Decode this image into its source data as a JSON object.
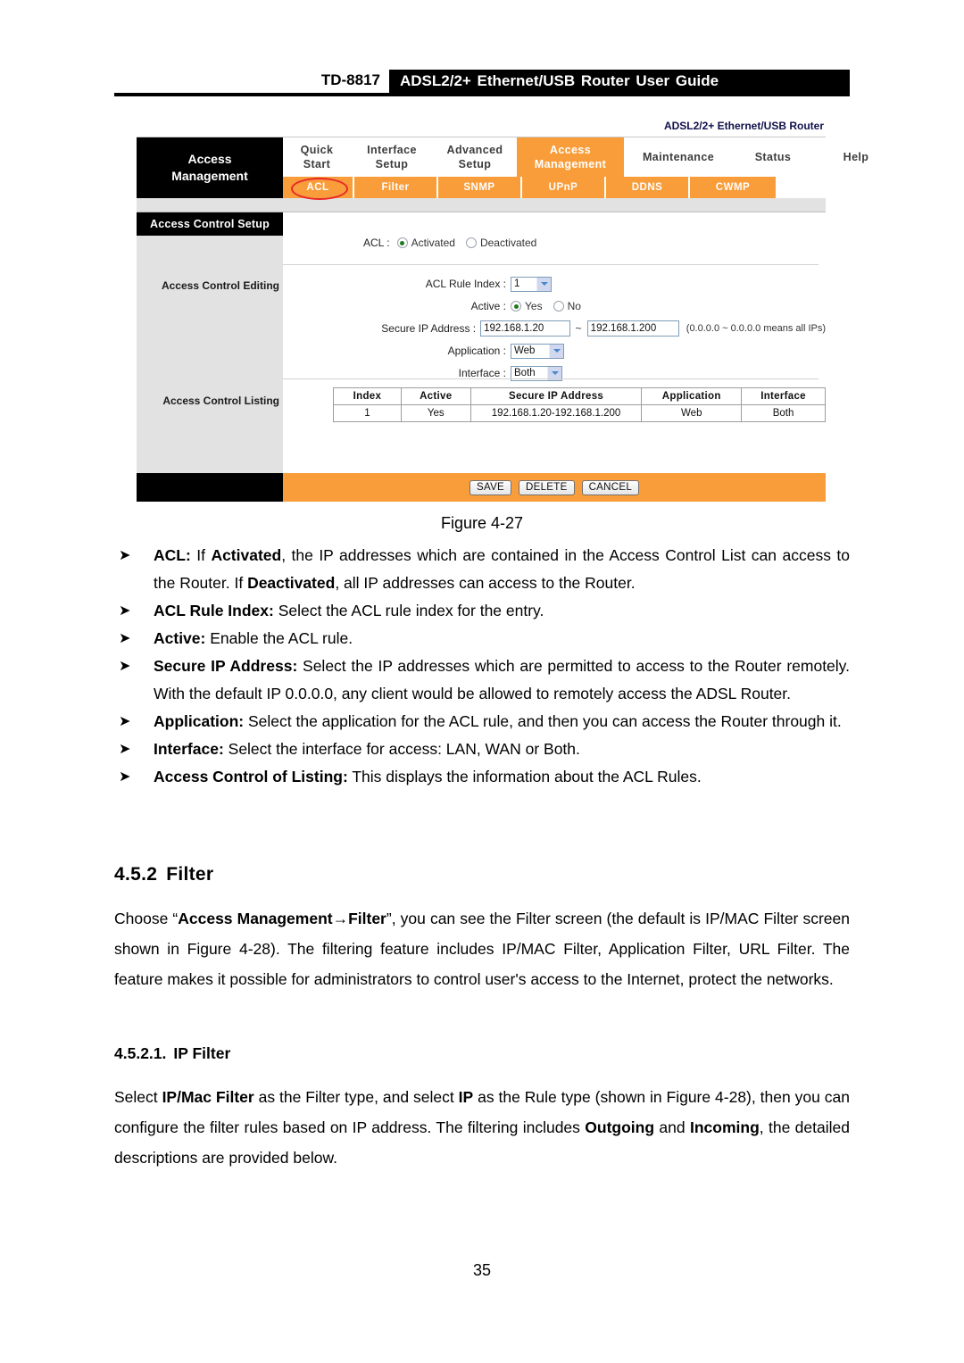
{
  "header": {
    "model": "TD-8817",
    "title": "ADSL2/2+ Ethernet/USB Router User Guide"
  },
  "router_ui": {
    "brandline": "ADSL2/2+ Ethernet/USB Router",
    "logo_line1": "Access",
    "logo_line2": "Management",
    "main_tabs": [
      {
        "line1": "Quick",
        "line2": "Start",
        "active": false
      },
      {
        "line1": "Interface",
        "line2": "Setup",
        "active": false
      },
      {
        "line1": "Advanced",
        "line2": "Setup",
        "active": false
      },
      {
        "line1": "Access",
        "line2": "Management",
        "active": true
      },
      {
        "line1": "Maintenance",
        "line2": "",
        "active": false
      },
      {
        "line1": "Status",
        "line2": "",
        "active": false
      },
      {
        "line1": "Help",
        "line2": "",
        "active": false
      }
    ],
    "sub_tabs": [
      {
        "label": "ACL",
        "selected": true
      },
      {
        "label": "Filter",
        "selected": false
      },
      {
        "label": "SNMP",
        "selected": false
      },
      {
        "label": "UPnP",
        "selected": false
      },
      {
        "label": "DDNS",
        "selected": false
      },
      {
        "label": "CWMP",
        "selected": false
      }
    ],
    "left_panel": {
      "title": "Access Control Setup",
      "editing_label": "Access Control Editing",
      "listing_label": "Access Control Listing"
    },
    "form": {
      "acl_label": "ACL :",
      "acl_option_activated": "Activated",
      "acl_option_deactivated": "Deactivated",
      "acl_selected": "Activated",
      "rule_index_label": "ACL Rule Index :",
      "rule_index_value": "1",
      "active_label": "Active :",
      "active_yes": "Yes",
      "active_no": "No",
      "active_selected": "Yes",
      "secure_ip_label": "Secure IP Address :",
      "secure_ip_start": "192.168.1.20",
      "secure_ip_separator": "~",
      "secure_ip_end": "192.168.1.200",
      "secure_ip_hint": "(0.0.0.0 ~ 0.0.0.0 means all IPs)",
      "application_label": "Application :",
      "application_value": "Web",
      "interface_label": "Interface :",
      "interface_value": "Both"
    },
    "listing_table": {
      "columns": [
        "Index",
        "Active",
        "Secure IP Address",
        "Application",
        "Interface"
      ],
      "rows": [
        [
          "1",
          "Yes",
          "192.168.1.20-192.168.1.200",
          "Web",
          "Both"
        ]
      ]
    },
    "buttons": {
      "save": "SAVE",
      "delete": "DELETE",
      "cancel": "CANCEL"
    },
    "accent_color": "#f99d3a",
    "highlight_color": "#e8282a"
  },
  "figure_caption": "Figure 4-27",
  "bullets": [
    {
      "marker": "➤",
      "parts": [
        {
          "t": "ACL:",
          "b": true
        },
        {
          "t": " If ",
          "b": false
        },
        {
          "t": "Activated",
          "b": true
        },
        {
          "t": ", the IP addresses which are contained in the Access Control List can access to the Router. If ",
          "b": false
        },
        {
          "t": "Deactivated",
          "b": true
        },
        {
          "t": ", all IP addresses can access to the Router.",
          "b": false
        }
      ]
    },
    {
      "marker": "➤",
      "parts": [
        {
          "t": "ACL Rule Index:",
          "b": true
        },
        {
          "t": " Select the ACL rule index for the entry.",
          "b": false
        }
      ]
    },
    {
      "marker": "➤",
      "parts": [
        {
          "t": "Active:",
          "b": true
        },
        {
          "t": " Enable the ACL rule.",
          "b": false
        }
      ]
    },
    {
      "marker": "➤",
      "parts": [
        {
          "t": "Secure IP Address:",
          "b": true
        },
        {
          "t": " Select the IP addresses which are permitted to access to the Router remotely. With the default IP 0.0.0.0, any client would be allowed to remotely access the ADSL Router.",
          "b": false
        }
      ]
    },
    {
      "marker": "➤",
      "parts": [
        {
          "t": "Application:",
          "b": true
        },
        {
          "t": " Select the application for the ACL rule, and then you can access the Router through it.",
          "b": false
        }
      ]
    },
    {
      "marker": "➤",
      "parts": [
        {
          "t": "Interface:",
          "b": true
        },
        {
          "t": " Select the interface for access: LAN, WAN or Both.",
          "b": false
        }
      ]
    },
    {
      "marker": "➤",
      "parts": [
        {
          "t": "Access Control of Listing:",
          "b": true
        },
        {
          "t": " This displays the information about the ACL Rules.",
          "b": false
        }
      ]
    }
  ],
  "section": {
    "number": "4.5.2",
    "title": "Filter"
  },
  "paragraph1": [
    {
      "t": "Choose “",
      "b": false
    },
    {
      "t": "Access Management→Filter",
      "b": true
    },
    {
      "t": "”, you can see the Filter screen (the default is IP/MAC Filter screen shown in Figure 4-28). The filtering feature includes IP/MAC Filter, Application Filter, URL Filter. The feature makes it possible for administrators to control user's access to the Internet, protect the networks.",
      "b": false
    }
  ],
  "subsection": {
    "number": "4.5.2.1.",
    "title": "IP Filter"
  },
  "paragraph2": [
    {
      "t": "Select ",
      "b": false
    },
    {
      "t": "IP/Mac Filter",
      "b": true
    },
    {
      "t": " as the Filter type, and select ",
      "b": false
    },
    {
      "t": "IP",
      "b": true
    },
    {
      "t": " as the Rule type (shown in Figure 4-28), then you can configure the filter rules based on IP address. The filtering includes ",
      "b": false
    },
    {
      "t": "Outgoing",
      "b": true
    },
    {
      "t": " and ",
      "b": false
    },
    {
      "t": "Incoming",
      "b": true
    },
    {
      "t": ", the detailed descriptions are provided below.",
      "b": false
    }
  ],
  "page_number": "35"
}
